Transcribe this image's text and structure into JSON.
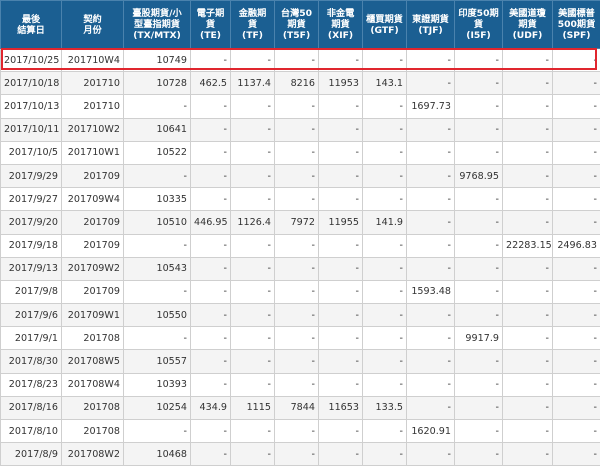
{
  "columns": [
    {
      "line1": "最後",
      "line2": "結算日"
    },
    {
      "line1": "契約",
      "line2": "月份"
    },
    {
      "line1": "臺股期貨/小",
      "line2": "型臺指期貨",
      "line3": "(TX/MTX)"
    },
    {
      "line1": "電子期",
      "line2": "貨",
      "line3": "(TE)"
    },
    {
      "line1": "金融期",
      "line2": "貨",
      "line3": "(TF)"
    },
    {
      "line1": "台灣50",
      "line2": "期貨",
      "line3": "(T5F)"
    },
    {
      "line1": "非金電",
      "line2": "期貨",
      "line3": "(XIF)"
    },
    {
      "line1": "櫃買期貨",
      "line2": "(GTF)"
    },
    {
      "line1": "東證期貨",
      "line2": "(TJF)"
    },
    {
      "line1": "印度50期",
      "line2": "貨",
      "line3": "(I5F)"
    },
    {
      "line1": "美國道瓊",
      "line2": "期貨",
      "line3": "(UDF)"
    },
    {
      "line1": "美國標普",
      "line2": "500期貨",
      "line3": "(SPF)"
    }
  ],
  "rows": [
    [
      "2017/10/25",
      "201710W4",
      "10749",
      "-",
      "-",
      "-",
      "-",
      "-",
      "-",
      "-",
      "-",
      "-"
    ],
    [
      "2017/10/18",
      "201710",
      "10728",
      "462.5",
      "1137.4",
      "8216",
      "11953",
      "143.1",
      "-",
      "-",
      "-",
      "-"
    ],
    [
      "2017/10/13",
      "201710",
      "-",
      "-",
      "-",
      "-",
      "-",
      "-",
      "1697.73",
      "-",
      "-",
      "-"
    ],
    [
      "2017/10/11",
      "201710W2",
      "10641",
      "-",
      "-",
      "-",
      "-",
      "-",
      "-",
      "-",
      "-",
      "-"
    ],
    [
      "2017/10/5",
      "201710W1",
      "10522",
      "-",
      "-",
      "-",
      "-",
      "-",
      "-",
      "-",
      "-",
      "-"
    ],
    [
      "2017/9/29",
      "201709",
      "-",
      "-",
      "-",
      "-",
      "-",
      "-",
      "-",
      "9768.95",
      "-",
      "-"
    ],
    [
      "2017/9/27",
      "201709W4",
      "10335",
      "-",
      "-",
      "-",
      "-",
      "-",
      "-",
      "-",
      "-",
      "-"
    ],
    [
      "2017/9/20",
      "201709",
      "10510",
      "446.95",
      "1126.4",
      "7972",
      "11955",
      "141.9",
      "-",
      "-",
      "-",
      "-"
    ],
    [
      "2017/9/18",
      "201709",
      "-",
      "-",
      "-",
      "-",
      "-",
      "-",
      "-",
      "-",
      "22283.15",
      "2496.83"
    ],
    [
      "2017/9/13",
      "201709W2",
      "10543",
      "-",
      "-",
      "-",
      "-",
      "-",
      "-",
      "-",
      "-",
      "-"
    ],
    [
      "2017/9/8",
      "201709",
      "-",
      "-",
      "-",
      "-",
      "-",
      "-",
      "1593.48",
      "-",
      "-",
      "-"
    ],
    [
      "2017/9/6",
      "201709W1",
      "10550",
      "-",
      "-",
      "-",
      "-",
      "-",
      "-",
      "-",
      "-",
      "-"
    ],
    [
      "2017/9/1",
      "201708",
      "-",
      "-",
      "-",
      "-",
      "-",
      "-",
      "-",
      "9917.9",
      "-",
      "-"
    ],
    [
      "2017/8/30",
      "201708W5",
      "10557",
      "-",
      "-",
      "-",
      "-",
      "-",
      "-",
      "-",
      "-",
      "-"
    ],
    [
      "2017/8/23",
      "201708W4",
      "10393",
      "-",
      "-",
      "-",
      "-",
      "-",
      "-",
      "-",
      "-",
      "-"
    ],
    [
      "2017/8/16",
      "201708",
      "10254",
      "434.9",
      "1115",
      "7844",
      "11653",
      "133.5",
      "-",
      "-",
      "-",
      "-"
    ],
    [
      "2017/8/10",
      "201708",
      "-",
      "-",
      "-",
      "-",
      "-",
      "-",
      "1620.91",
      "-",
      "-",
      "-"
    ],
    [
      "2017/8/9",
      "201708W2",
      "10468",
      "-",
      "-",
      "-",
      "-",
      "-",
      "-",
      "-",
      "-",
      "-"
    ]
  ],
  "highlight": {
    "color": "#e0262e",
    "row": 0
  }
}
